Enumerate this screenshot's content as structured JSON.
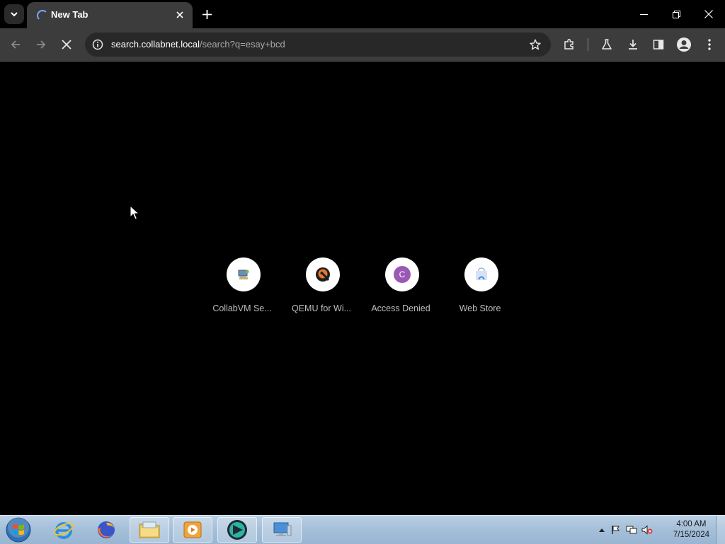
{
  "browser": {
    "tab": {
      "title": "New Tab"
    },
    "omnibox": {
      "url_host": "search.collabnet.local",
      "url_path": "/search?q=esay+bcd"
    }
  },
  "shortcuts": [
    {
      "label": "CollabVM Se...",
      "icon": "collabvm-icon"
    },
    {
      "label": "QEMU for Wi...",
      "icon": "qemu-icon"
    },
    {
      "label": "Access Denied",
      "icon": "letter-c-icon",
      "letter": "C",
      "color": "#9b59b6"
    },
    {
      "label": "Web Store",
      "icon": "webstore-icon"
    }
  ],
  "taskbar": {
    "clock": {
      "time": "4:00 AM",
      "date": "7/15/2024"
    }
  },
  "colors": {
    "page_bg": "#000000",
    "toolbar_bg": "#3c3c3c",
    "accent": "#7aa7ff"
  }
}
